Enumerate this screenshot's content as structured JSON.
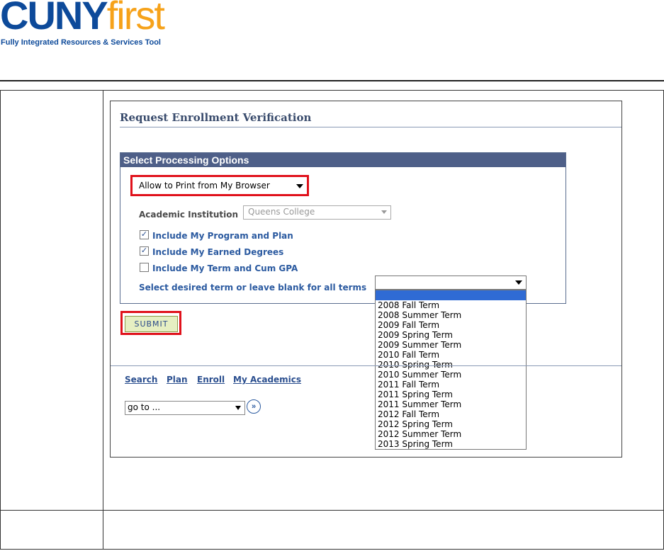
{
  "logo": {
    "name_main": "CUNY",
    "name_accent": "first",
    "tagline": "Fully Integrated Resources & Services Tool"
  },
  "page": {
    "title": "Request Enrollment Verification",
    "section_header": "Select Processing Options",
    "print_option": "Allow to Print from My Browser",
    "institution_label": "Academic Institution",
    "institution_value": "Queens College",
    "checkboxes": [
      {
        "label": "Include My Program and Plan",
        "checked": true
      },
      {
        "label": "Include My Earned Degrees",
        "checked": true
      },
      {
        "label": "Include My Term and Cum GPA",
        "checked": false
      }
    ],
    "term_label": "Select desired term or leave blank for all terms",
    "term_value": "",
    "term_options": [
      "2008 Fall Term",
      "2008 Summer Term",
      "2009 Fall Term",
      "2009 Spring Term",
      "2009 Summer Term",
      "2010 Fall Term",
      "2010 Spring Term",
      "2010 Summer Term",
      "2011 Fall Term",
      "2011 Spring Term",
      "2011 Summer Term",
      "2012 Fall Term",
      "2012 Spring Term",
      "2012 Summer Term",
      "2013 Spring Term"
    ],
    "submit_label": "Submit",
    "links": [
      "Search",
      "Plan",
      "Enroll",
      "My Academics"
    ],
    "goto_value": "go to ..."
  },
  "colors": {
    "brand_blue": "#0d4a9a",
    "brand_orange": "#f6a21a",
    "highlight_red": "#e0111b",
    "header_bar": "#4e5f88"
  }
}
